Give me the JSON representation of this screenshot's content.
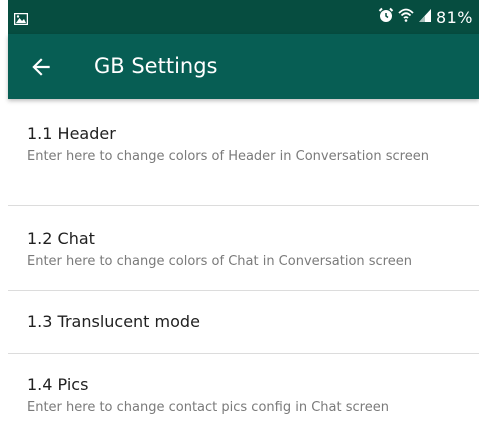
{
  "status_bar": {
    "battery": "81%",
    "icons": [
      "image-icon",
      "alarm-icon",
      "wifi-icon",
      "signal-icon"
    ]
  },
  "app_bar": {
    "title": "GB Settings",
    "back_icon": "arrow-back-icon"
  },
  "items": [
    {
      "title": "1.1 Header",
      "subtitle": "Enter here to change colors of Header in Conversation screen"
    },
    {
      "title": "1.2 Chat",
      "subtitle": "Enter here to change colors of Chat in Conversation screen"
    },
    {
      "title": "1.3 Translucent mode"
    },
    {
      "title": "1.4 Pics",
      "subtitle": "Enter here to change contact pics config in Chat screen"
    }
  ],
  "colors": {
    "status_bar": "#064d40",
    "app_bar": "#075e54",
    "divider": "#dcdcdc"
  }
}
